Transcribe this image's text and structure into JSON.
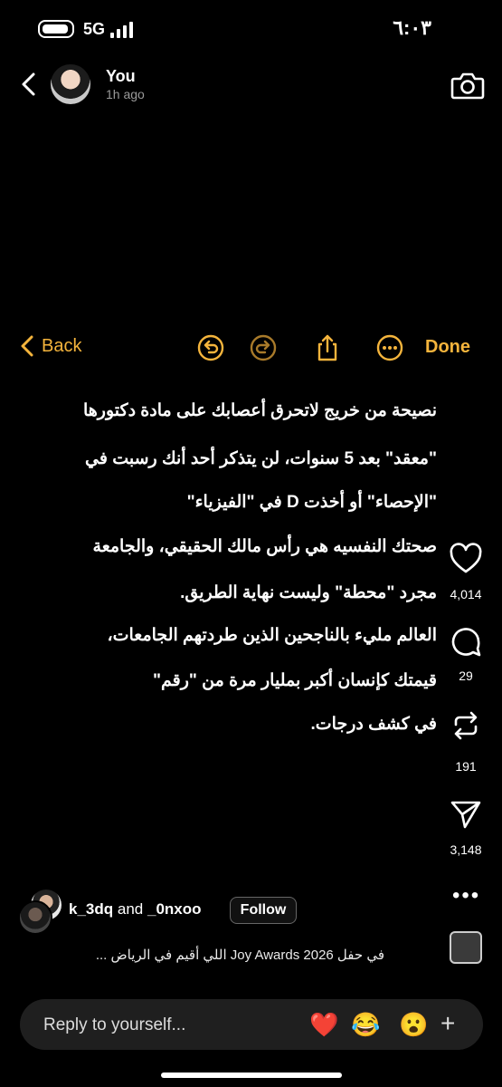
{
  "status": {
    "network": "5G",
    "time": "٦:٠٣"
  },
  "header": {
    "user_name": "You",
    "timestamp": "1h ago",
    "back_icon": "chevron-left-icon",
    "camera_icon": "camera-icon"
  },
  "notes_toolbar": {
    "back_label": "Back",
    "done_label": "Done",
    "accent_color": "#f4b43c",
    "icons": [
      "undo-icon",
      "redo-icon",
      "share-icon",
      "more-icon"
    ]
  },
  "note_lines": [
    "نصيحة من خريج لاتحرق أعصابك على مادة دكتورها",
    "\"معقد\" بعد 5 سنوات، لن يتذكر أحد أنك رسبت في",
    "\"الإحصاء\" أو أخذت D في \"الفيزياء\"",
    "صحتك النفسيه هي رأس مالك الحقيقي، والجامعة",
    "مجرد \"محطة\" وليست نهاية الطريق.",
    "العالم مليء بالناجحين الذين طردتهم الجامعات،",
    "قيمتك كإنسان أكبر بمليار مرة من \"رقم\"",
    "في كشف درجات."
  ],
  "actions": {
    "likes": "4,014",
    "comments": "29",
    "reposts": "191",
    "shares": "3,148"
  },
  "collab": {
    "user1": "k_3dq",
    "joiner": "and",
    "user2": "_0nxoo",
    "follow_label": "Follow"
  },
  "caption": "في حفل Joy Awards 2026 اللي أقيم في الرياض ...",
  "reply": {
    "placeholder": "Reply to yourself...",
    "reactions": [
      "❤️",
      "😂",
      "😮"
    ],
    "plus": "+"
  }
}
